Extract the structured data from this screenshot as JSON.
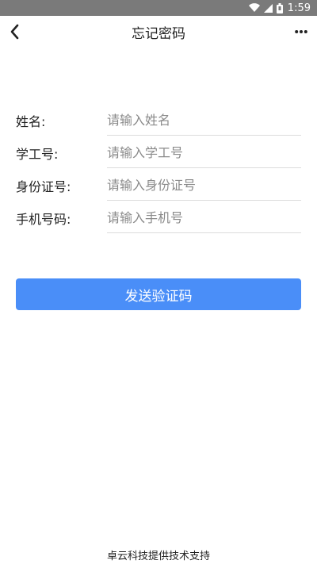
{
  "status_bar": {
    "time": "1:59",
    "icons": [
      "wifi-icon",
      "signal-icon",
      "battery-icon"
    ]
  },
  "nav": {
    "title": "忘记密码",
    "back_icon": "chevron-left-icon",
    "more_icon": "more-icon"
  },
  "form": {
    "fields": [
      {
        "label": "姓名:",
        "placeholder": "请输入姓名",
        "value": ""
      },
      {
        "label": "学工号:",
        "placeholder": "请输入学工号",
        "value": ""
      },
      {
        "label": "身份证号:",
        "placeholder": "请输入身份证号",
        "value": ""
      },
      {
        "label": "手机号码:",
        "placeholder": "请输入手机号",
        "value": ""
      }
    ]
  },
  "send_button": {
    "label": "发送验证码"
  },
  "footer": {
    "text": "卓云科技提供技术支持"
  },
  "colors": {
    "status_bar": "#7a7a7a",
    "accent": "#4a8ef8",
    "divider": "#dcdcdc",
    "placeholder": "#8a8a8a"
  }
}
